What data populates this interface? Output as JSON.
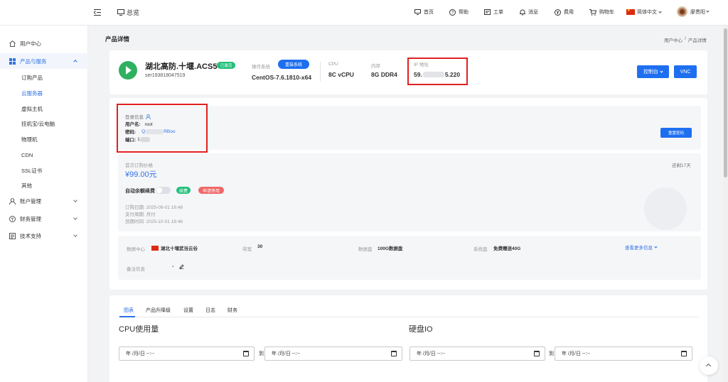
{
  "header": {
    "overview": "总览",
    "nav": [
      {
        "label": "首页",
        "icon": "monitor-icon"
      },
      {
        "label": "帮助",
        "icon": "help-icon"
      },
      {
        "label": "工单",
        "icon": "ticket-icon"
      },
      {
        "label": "消息",
        "icon": "bell-icon"
      },
      {
        "label": "费用",
        "icon": "yen-icon"
      },
      {
        "label": "购物车",
        "icon": "cart-icon"
      }
    ],
    "language": "简体中文",
    "username": "廖贵阳"
  },
  "sidebar": {
    "items": [
      {
        "label": "用户中心"
      },
      {
        "label": "产品与服务"
      },
      {
        "label": "订购产品"
      },
      {
        "label": "云服务器"
      },
      {
        "label": "虚拟主机"
      },
      {
        "label": "挂机宝/云电脑"
      },
      {
        "label": "物理机"
      },
      {
        "label": "CDN"
      },
      {
        "label": "SSL证书"
      },
      {
        "label": "其他"
      },
      {
        "label": "账户管理"
      },
      {
        "label": "财务管理"
      },
      {
        "label": "技术支持"
      }
    ]
  },
  "page": {
    "title": "产品详情",
    "breadcrumb": [
      "用户中心",
      "产品详情"
    ]
  },
  "product": {
    "name": "湖北高防.十堰.ACS5",
    "status": "已激活",
    "id": "ser193818047519",
    "os_label": "操作系统",
    "reinstall": "重装系统",
    "os_value": "CentOS-7.6.1810-x64",
    "cpu_label": "CPU",
    "cpu_value": "8C vCPU",
    "mem_label": "内存",
    "mem_value": "8G DDR4",
    "ip_label": "IP 地址",
    "ip_value_start": "59.",
    "ip_value_end": "5.220",
    "console_btn": "控制台",
    "vnc_btn": "VNC"
  },
  "login": {
    "title": "登录信息",
    "username_label": "用户名:",
    "username_value": "root",
    "password_label": "密码:",
    "password_start": "Q",
    "password_end": "RBoo",
    "port_label": "端口:",
    "port_start": "1",
    "reset_btn": "重置密码"
  },
  "billing": {
    "first_price_label": "首次订购价格",
    "price": "¥99.00元",
    "remaining": "还剩17天",
    "auto_renew_label": "自动余额续费",
    "renew_btn": "续费",
    "cancel_btn": "申请停用",
    "order_date": "订购日期:  2025-09-01 18:48",
    "payment_cycle": "支付周期:  月付",
    "expire_date": "到期时间:  2025-10-01 18:48"
  },
  "details": {
    "dc_label": "数据中心",
    "dc_value": "湖北十堰武当云谷",
    "bw_label": "带宽",
    "bw_value": "30",
    "disk_label": "数据盘",
    "disk_value": "100G数据盘",
    "sysdisk_label": "系统盘",
    "sysdisk_value": "免费赠送40G",
    "more": "查看更多信息",
    "remark_label": "备注信息",
    "remark_value": "-"
  },
  "tabs": [
    "图表",
    "产品升降级",
    "设置",
    "日志",
    "财务"
  ],
  "charts": {
    "cpu_title": "CPU使用量",
    "disk_title": "硬盘IO",
    "date_placeholder": "年 /月/日 --:--",
    "to": "到"
  },
  "colors": {
    "accent": "#1e6ff0",
    "success": "#23c07b",
    "danger": "#ef6767",
    "highlight": "#e02020"
  }
}
